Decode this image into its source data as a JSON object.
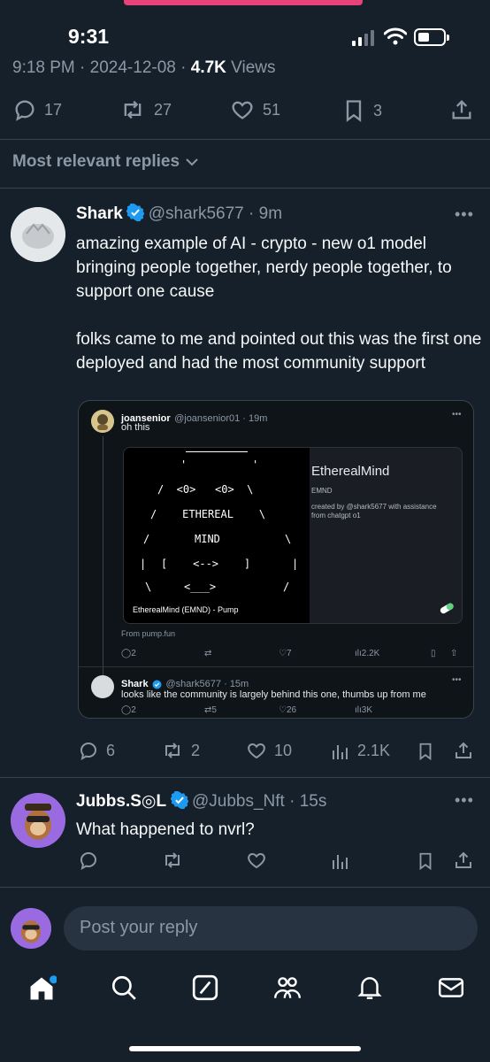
{
  "status_bar": {
    "time": "9:31"
  },
  "post": {
    "time": "9:18 PM",
    "date": "2024-12-08",
    "views_count": "4.7K",
    "views_label": "Views",
    "stats": {
      "replies": "17",
      "reposts": "27",
      "likes": "51",
      "bookmarks": "3"
    }
  },
  "replies_filter": {
    "label": "Most relevant replies"
  },
  "reply_shark": {
    "name": "Shark",
    "handle": "@shark5677",
    "age": "9m",
    "text_p1": "amazing example of AI - crypto - new o1 model bringing people together, nerdy people together, to support one cause",
    "text_p2": "folks came to me and pointed out this was the first one deployed and had the most community support",
    "stats": {
      "replies": "6",
      "reposts": "2",
      "likes": "10",
      "views": "2.1K"
    }
  },
  "quote": {
    "author_name": "joansenior",
    "author_handle": "@joansenior01",
    "age": "19m",
    "text": "oh this",
    "embed": {
      "ascii_l1": "/  <0>   <0>  \\",
      "ascii_l2": "/    ETHEREAL    \\",
      "ascii_l3": "MIND",
      "ascii_l4": "[    <-->    ]",
      "ascii_l5": "<___>",
      "caption": "EtherealMind (EMND) - Pump",
      "title": "EtherealMind",
      "ticker": "EMND",
      "created_by": "created by @shark5677 with assistance from chatgpt o1"
    },
    "source": "From pump.fun",
    "stats": {
      "replies": "2",
      "likes": "7",
      "views": "2.2K"
    },
    "nested": {
      "name": "Shark",
      "handle": "@shark5677",
      "age": "15m",
      "text": "looks like the community is largely behind this one, thumbs up from me",
      "stats": {
        "replies": "2",
        "reposts": "5",
        "likes": "26",
        "views": "3K"
      }
    }
  },
  "reply_jubbs": {
    "name": "Jubbs.S◎L",
    "handle": "@Jubbs_Nft",
    "age": "15s",
    "text": "What happened to nvrl?"
  },
  "composer": {
    "placeholder": "Post your reply"
  },
  "colors": {
    "background": "#15202b",
    "accent": "#1d9bf0",
    "muted": "#8b98a5"
  }
}
